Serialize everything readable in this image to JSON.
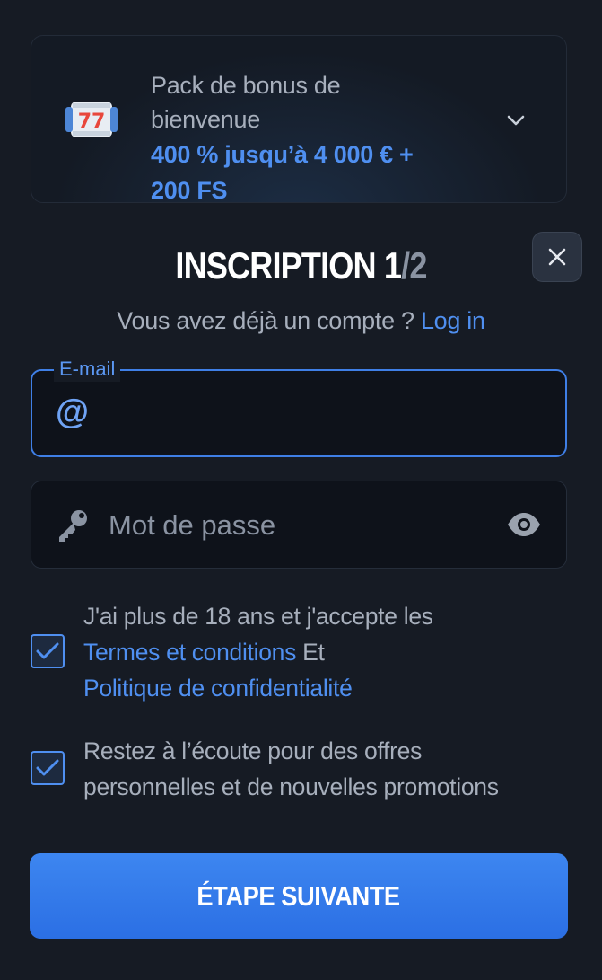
{
  "bonus": {
    "title": "Pack de bonus de bienvenue",
    "offer_line1": "400 % jusqu’à 4 000 € +",
    "offer_line2": "200 FS",
    "icon": "slot-reel-777-icon"
  },
  "heading": {
    "title": "INSCRIPTION",
    "step_current": "1",
    "step_total": "/2"
  },
  "login": {
    "prompt": "Vous avez déjà un compte ?",
    "link": "Log in"
  },
  "email": {
    "label": "E-mail",
    "value": "",
    "placeholder": ""
  },
  "password": {
    "placeholder": "Mot de passe",
    "value": ""
  },
  "consent": {
    "age_text": "J'ai plus de 18 ans et j'accepte les",
    "terms_link": "Termes et conditions",
    "and_word": "Et",
    "privacy_link": "Politique de confidentialité",
    "age_checked": true,
    "promo_text_line1": "Restez à l’écoute pour des offres",
    "promo_text_line2": "personnelles et de nouvelles promotions",
    "promo_checked": true
  },
  "submit": {
    "label": "ÉTAPE SUIVANTE"
  },
  "colors": {
    "accent": "#4f8ff0",
    "background": "#161b24",
    "button": "#2b6fe4"
  }
}
